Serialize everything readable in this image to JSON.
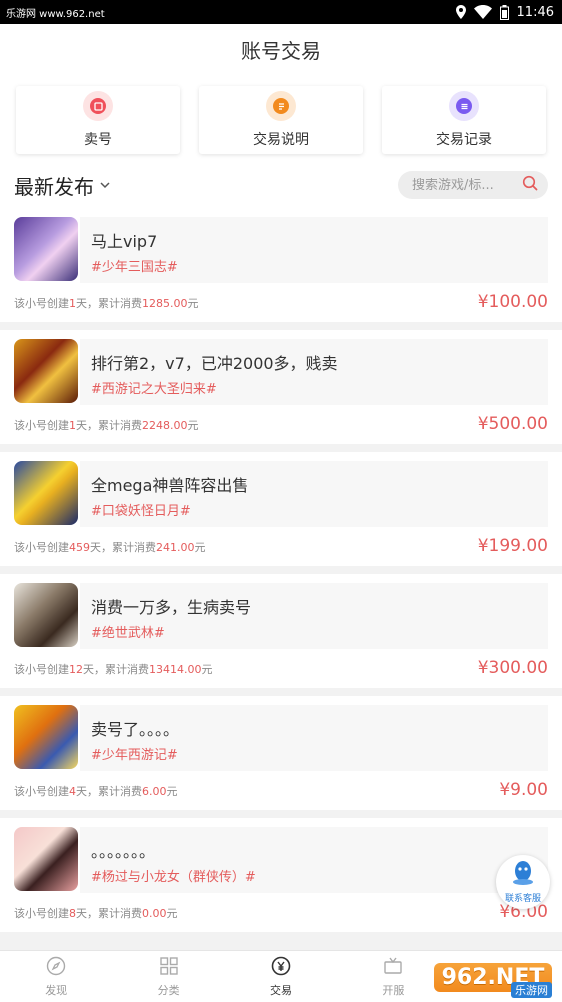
{
  "statusbar": {
    "watermark_text": "乐游网 www.962.net",
    "time": "11:46"
  },
  "header": {
    "title": "账号交易"
  },
  "quick_actions": [
    {
      "label": "卖号",
      "icon": "sell-icon",
      "color": "#f0505a"
    },
    {
      "label": "交易说明",
      "icon": "doc-icon",
      "color": "#f28a1e"
    },
    {
      "label": "交易记录",
      "icon": "record-icon",
      "color": "#7a5af0"
    }
  ],
  "section": {
    "title": "最新发布",
    "search_placeholder": "搜索游戏/标..."
  },
  "listings": [
    {
      "title": "马上vip7",
      "tag": "#少年三国志#",
      "meta_pre": "该小号创建",
      "days": "1",
      "meta_mid": "天，累计消费",
      "spend": "1285.00",
      "meta_post": "元",
      "price": "¥100.00"
    },
    {
      "title": "排行第2，v7，已冲2000多，贱卖",
      "tag": "#西游记之大圣归来#",
      "meta_pre": "该小号创建",
      "days": "1",
      "meta_mid": "天，累计消费",
      "spend": "2248.00",
      "meta_post": "元",
      "price": "¥500.00"
    },
    {
      "title": "全mega神兽阵容出售",
      "tag": "#口袋妖怪日月#",
      "meta_pre": "该小号创建",
      "days": "459",
      "meta_mid": "天，累计消费",
      "spend": "241.00",
      "meta_post": "元",
      "price": "¥199.00"
    },
    {
      "title": "消费一万多，生病卖号",
      "tag": "#绝世武林#",
      "meta_pre": "该小号创建",
      "days": "12",
      "meta_mid": "天，累计消费",
      "spend": "13414.00",
      "meta_post": "元",
      "price": "¥300.00"
    },
    {
      "title": "卖号了。。。。",
      "tag": "#少年西游记#",
      "meta_pre": "该小号创建",
      "days": "4",
      "meta_mid": "天，累计消费",
      "spend": "6.00",
      "meta_post": "元",
      "price": "¥9.00"
    },
    {
      "title": "。。。。。。。",
      "tag": "#杨过与小龙女（群侠传）#",
      "meta_pre": "该小号创建",
      "days": "8",
      "meta_mid": "天，累计消费",
      "spend": "0.00",
      "meta_post": "元",
      "price": "¥6.00"
    }
  ],
  "float_service": {
    "label": "联系客服"
  },
  "tabs": [
    {
      "label": "发现",
      "icon": "compass-icon"
    },
    {
      "label": "分类",
      "icon": "grid-icon"
    },
    {
      "label": "交易",
      "icon": "trade-icon"
    },
    {
      "label": "开服",
      "icon": "server-icon"
    },
    {
      "label": "",
      "icon": ""
    }
  ],
  "watermark": {
    "text": "962.NET",
    "sub": "乐游网"
  }
}
